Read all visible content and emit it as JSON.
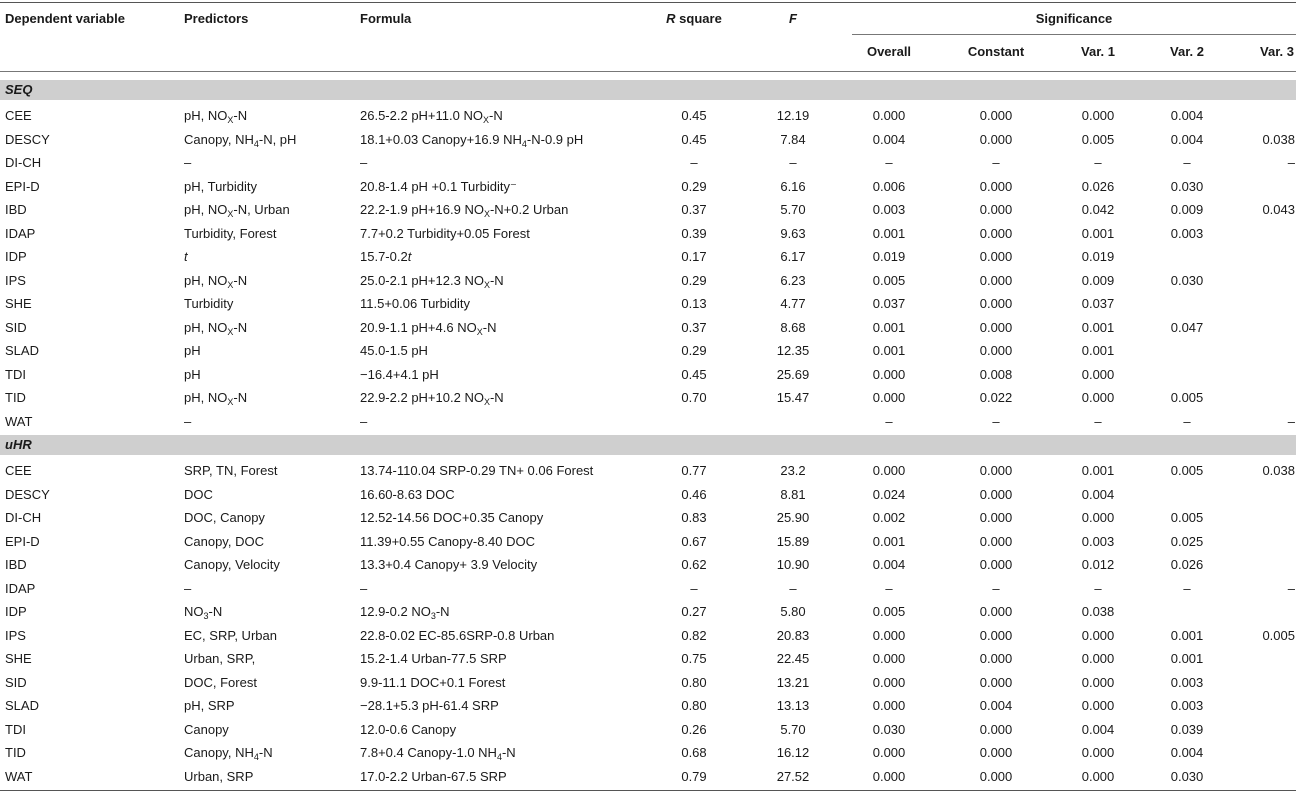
{
  "headers": {
    "dependent_variable": "Dependent variable",
    "predictors": "Predictors",
    "formula": "Formula",
    "r_square_r": "R",
    "r_square_rest": " square",
    "f": "F",
    "significance": "Significance",
    "overall": "Overall",
    "constant": "Constant",
    "var1": "Var. 1",
    "var2": "Var. 2",
    "var3": "Var. 3"
  },
  "sections": [
    {
      "label": "SEQ",
      "rows": [
        {
          "dep": "CEE",
          "pred": "pH, NO_{X}-N",
          "formula": "26.5-2.2 pH+11.0 NO_{X}-N",
          "r2": "0.45",
          "f": "12.19",
          "overall": "0.000",
          "constant": "0.000",
          "v1": "0.000",
          "v2": "0.004",
          "v3": ""
        },
        {
          "dep": "DESCY",
          "pred": "Canopy, NH_{4}-N, pH",
          "formula": "18.1+0.03 Canopy+16.9 NH_{4}-N-0.9 pH",
          "r2": "0.45",
          "f": "7.84",
          "overall": "0.004",
          "constant": "0.000",
          "v1": "0.005",
          "v2": "0.004",
          "v3": "0.038"
        },
        {
          "dep": "DI-CH",
          "pred": "–",
          "formula": "–",
          "r2": "–",
          "f": "–",
          "overall": "–",
          "constant": "–",
          "v1": "–",
          "v2": "–",
          "v3": "–"
        },
        {
          "dep": "EPI-D",
          "pred": "pH, Turbidity",
          "formula": "20.8-1.4 pH +0.1 Turbidity⁻",
          "r2": "0.29",
          "f": "6.16",
          "overall": "0.006",
          "constant": "0.000",
          "v1": "0.026",
          "v2": "0.030",
          "v3": ""
        },
        {
          "dep": "IBD",
          "pred": "pH, NO_{X}-N, Urban",
          "formula": "22.2-1.9 pH+16.9 NO_{X}-N+0.2 Urban",
          "r2": "0.37",
          "f": "5.70",
          "overall": "0.003",
          "constant": "0.000",
          "v1": "0.042",
          "v2": "0.009",
          "v3": "0.043"
        },
        {
          "dep": "IDAP",
          "pred": "Turbidity, Forest",
          "formula": "7.7+0.2 Turbidity+0.05 Forest",
          "r2": "0.39",
          "f": "9.63",
          "overall": "0.001",
          "constant": "0.000",
          "v1": "0.001",
          "v2": "0.003",
          "v3": ""
        },
        {
          "dep": "IDP",
          "pred": "t",
          "formula": "15.7-0.2t",
          "r2": "0.17",
          "f": "6.17",
          "overall": "0.019",
          "constant": "0.000",
          "v1": "0.019",
          "v2": "",
          "v3": ""
        },
        {
          "dep": "IPS",
          "pred": "pH, NO_{X}-N",
          "formula": "25.0-2.1 pH+12.3 NO_{X}-N",
          "r2": "0.29",
          "f": "6.23",
          "overall": "0.005",
          "constant": "0.000",
          "v1": "0.009",
          "v2": "0.030",
          "v3": ""
        },
        {
          "dep": "SHE",
          "pred": "Turbidity",
          "formula": "11.5+0.06 Turbidity",
          "r2": "0.13",
          "f": "4.77",
          "overall": "0.037",
          "constant": "0.000",
          "v1": "0.037",
          "v2": "",
          "v3": ""
        },
        {
          "dep": "SID",
          "pred": "pH, NO_{X}-N",
          "formula": "20.9-1.1 pH+4.6 NO_{X}-N",
          "r2": "0.37",
          "f": "8.68",
          "overall": "0.001",
          "constant": "0.000",
          "v1": "0.001",
          "v2": "0.047",
          "v3": ""
        },
        {
          "dep": "SLAD",
          "pred": "pH",
          "formula": "45.0-1.5 pH",
          "r2": "0.29",
          "f": "12.35",
          "overall": "0.001",
          "constant": "0.000",
          "v1": "0.001",
          "v2": "",
          "v3": ""
        },
        {
          "dep": "TDI",
          "pred": "pH",
          "formula": "−16.4+4.1 pH",
          "r2": "0.45",
          "f": "25.69",
          "overall": "0.000",
          "constant": "0.008",
          "v1": "0.000",
          "v2": "",
          "v3": ""
        },
        {
          "dep": "TID",
          "pred": "pH, NO_{X}-N",
          "formula": "22.9-2.2 pH+10.2 NO_{X}-N",
          "r2": "0.70",
          "f": "15.47",
          "overall": "0.000",
          "constant": "0.022",
          "v1": "0.000",
          "v2": "0.005",
          "v3": ""
        },
        {
          "dep": "WAT",
          "pred": "–",
          "formula": "–",
          "r2": "",
          "f": "",
          "overall": "–",
          "constant": "–",
          "v1": "–",
          "v2": "–",
          "v3": "–"
        }
      ]
    },
    {
      "label": "uHR",
      "rows": [
        {
          "dep": "CEE",
          "pred": "SRP, TN, Forest",
          "formula": "13.74-110.04 SRP-0.29 TN+ 0.06 Forest",
          "r2": "0.77",
          "f": "23.2",
          "overall": "0.000",
          "constant": "0.000",
          "v1": "0.001",
          "v2": "0.005",
          "v3": "0.038"
        },
        {
          "dep": "DESCY",
          "pred": "DOC",
          "formula": "16.60-8.63 DOC",
          "r2": "0.46",
          "f": "8.81",
          "overall": "0.024",
          "constant": "0.000",
          "v1": "0.004",
          "v2": "",
          "v3": ""
        },
        {
          "dep": "DI-CH",
          "pred": "DOC, Canopy",
          "formula": "12.52-14.56 DOC+0.35 Canopy",
          "r2": "0.83",
          "f": "25.90",
          "overall": "0.002",
          "constant": "0.000",
          "v1": "0.000",
          "v2": "0.005",
          "v3": ""
        },
        {
          "dep": "EPI-D",
          "pred": "Canopy, DOC",
          "formula": "11.39+0.55 Canopy-8.40 DOC",
          "r2": "0.67",
          "f": "15.89",
          "overall": "0.001",
          "constant": "0.000",
          "v1": "0.003",
          "v2": "0.025",
          "v3": ""
        },
        {
          "dep": "IBD",
          "pred": "Canopy, Velocity",
          "formula": "13.3+0.4 Canopy+ 3.9 Velocity",
          "r2": "0.62",
          "f": "10.90",
          "overall": "0.004",
          "constant": "0.000",
          "v1": "0.012",
          "v2": "0.026",
          "v3": ""
        },
        {
          "dep": "IDAP",
          "pred": "–",
          "formula": "–",
          "r2": "–",
          "f": "–",
          "overall": "–",
          "constant": "–",
          "v1": "–",
          "v2": "–",
          "v3": "–"
        },
        {
          "dep": "IDP",
          "pred": "NO_{3}-N",
          "formula": "12.9-0.2 NO_{3}-N",
          "r2": "0.27",
          "f": "5.80",
          "overall": "0.005",
          "constant": "0.000",
          "v1": "0.038",
          "v2": "",
          "v3": ""
        },
        {
          "dep": "IPS",
          "pred": "EC, SRP, Urban",
          "formula": "22.8-0.02 EC-85.6SRP-0.8 Urban",
          "r2": "0.82",
          "f": "20.83",
          "overall": "0.000",
          "constant": "0.000",
          "v1": "0.000",
          "v2": "0.001",
          "v3": "0.005"
        },
        {
          "dep": "SHE",
          "pred": "Urban, SRP,",
          "formula": "15.2-1.4 Urban-77.5 SRP",
          "r2": "0.75",
          "f": "22.45",
          "overall": "0.000",
          "constant": "0.000",
          "v1": "0.000",
          "v2": "0.001",
          "v3": ""
        },
        {
          "dep": "SID",
          "pred": "DOC, Forest",
          "formula": "9.9-11.1 DOC+0.1 Forest",
          "r2": "0.80",
          "f": "13.21",
          "overall": "0.000",
          "constant": "0.000",
          "v1": "0.000",
          "v2": "0.003",
          "v3": ""
        },
        {
          "dep": "SLAD",
          "pred": "pH, SRP",
          "formula": "−28.1+5.3 pH-61.4 SRP",
          "r2": "0.80",
          "f": "13.13",
          "overall": "0.000",
          "constant": "0.004",
          "v1": "0.000",
          "v2": "0.003",
          "v3": ""
        },
        {
          "dep": "TDI",
          "pred": "Canopy",
          "formula": "12.0-0.6 Canopy",
          "r2": "0.26",
          "f": "5.70",
          "overall": "0.030",
          "constant": "0.000",
          "v1": "0.004",
          "v2": "0.039",
          "v3": ""
        },
        {
          "dep": "TID",
          "pred": "Canopy, NH_{4}-N",
          "formula": "7.8+0.4 Canopy-1.0 NH_{4}-N",
          "r2": "0.68",
          "f": "16.12",
          "overall": "0.000",
          "constant": "0.000",
          "v1": "0.000",
          "v2": "0.004",
          "v3": ""
        },
        {
          "dep": "WAT",
          "pred": "Urban, SRP",
          "formula": "17.0-2.2 Urban-67.5 SRP",
          "r2": "0.79",
          "f": "27.52",
          "overall": "0.000",
          "constant": "0.000",
          "v1": "0.000",
          "v2": "0.030",
          "v3": ""
        }
      ]
    }
  ]
}
